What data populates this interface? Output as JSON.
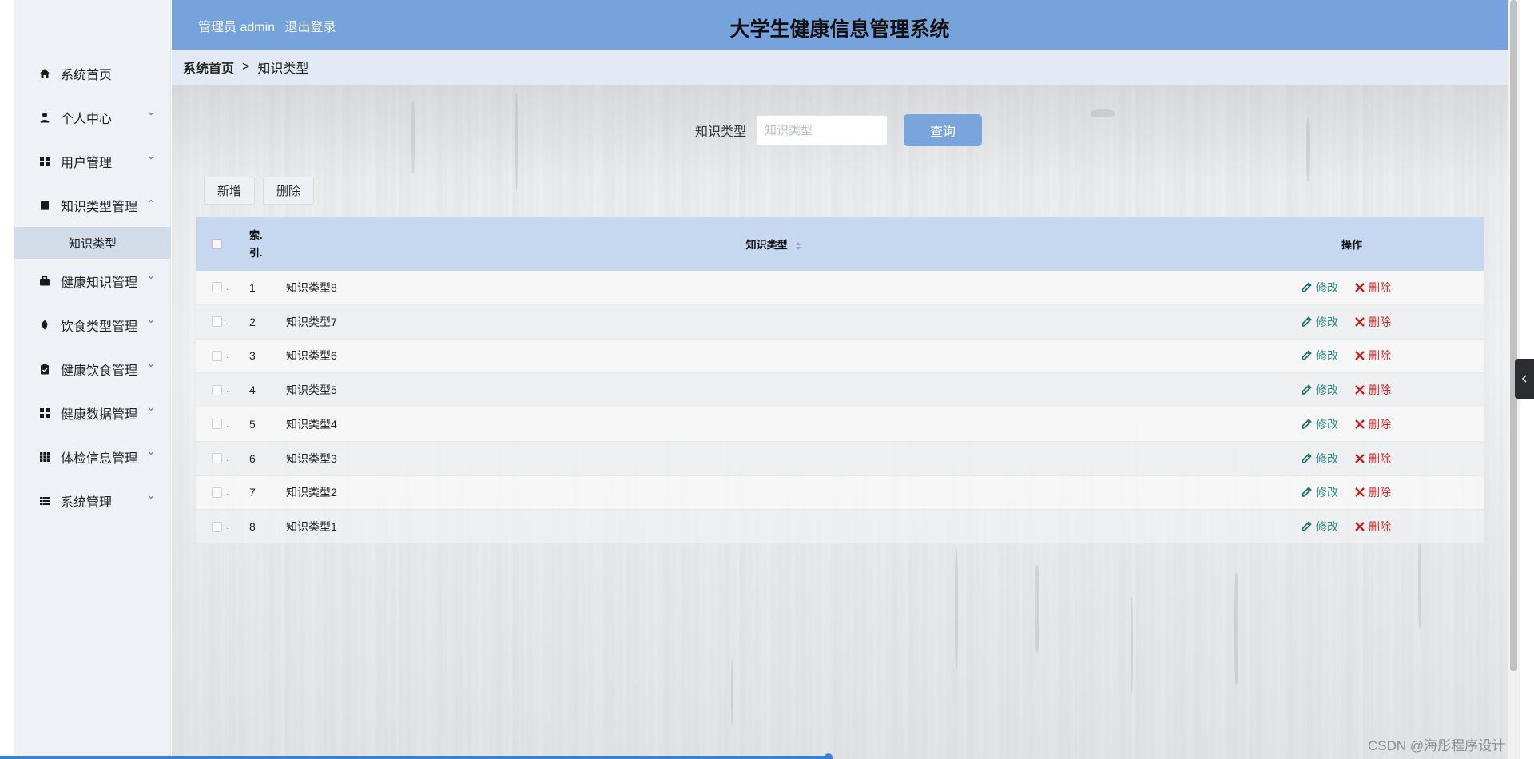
{
  "header": {
    "user_label": "管理员 admin",
    "logout_label": "退出登录",
    "title": "大学生健康信息管理系统"
  },
  "sidebar": {
    "items": [
      {
        "label": "系统首页",
        "icon": "home-icon",
        "has_children": false
      },
      {
        "label": "个人中心",
        "icon": "user-icon",
        "has_children": true
      },
      {
        "label": "用户管理",
        "icon": "grid-icon",
        "has_children": true
      },
      {
        "label": "知识类型管理",
        "icon": "book-icon",
        "has_children": true,
        "expanded": true,
        "children": [
          {
            "label": "知识类型",
            "active": true
          }
        ]
      },
      {
        "label": "健康知识管理",
        "icon": "briefcase-icon",
        "has_children": true
      },
      {
        "label": "饮食类型管理",
        "icon": "leaf-icon",
        "has_children": true
      },
      {
        "label": "健康饮食管理",
        "icon": "clipboard-icon",
        "has_children": true
      },
      {
        "label": "健康数据管理",
        "icon": "grid-icon",
        "has_children": true
      },
      {
        "label": "体检信息管理",
        "icon": "apps-icon",
        "has_children": true
      },
      {
        "label": "系统管理",
        "icon": "list-icon",
        "has_children": true
      }
    ]
  },
  "breadcrumb": {
    "home": "系统首页",
    "separator": ">",
    "current": "知识类型"
  },
  "search": {
    "label": "知识类型",
    "placeholder": "知识类型",
    "value": "",
    "button_label": "查询"
  },
  "toolbar": {
    "add_label": "新增",
    "delete_label": "删除"
  },
  "table": {
    "columns": {
      "index": "索.\n引.",
      "name": "知识类型",
      "actions": "操作"
    },
    "edit_label": "修改",
    "delete_label": "删除",
    "rows": [
      {
        "index": "1",
        "name": "知识类型8"
      },
      {
        "index": "2",
        "name": "知识类型7"
      },
      {
        "index": "3",
        "name": "知识类型6"
      },
      {
        "index": "4",
        "name": "知识类型5"
      },
      {
        "index": "5",
        "name": "知识类型4"
      },
      {
        "index": "6",
        "name": "知识类型3"
      },
      {
        "index": "7",
        "name": "知识类型2"
      },
      {
        "index": "8",
        "name": "知识类型1"
      }
    ]
  },
  "watermark": "CSDN @海彤程序设计",
  "video_progress": 0.54,
  "colors": {
    "header_bg": "#76a3dc",
    "breadcrumb_bg": "#e2ebf5",
    "table_header_bg": "#c6d8ef",
    "edit_color": "#2a8a8a",
    "delete_color": "#c22323",
    "search_button_bg": "#79a5dc"
  }
}
